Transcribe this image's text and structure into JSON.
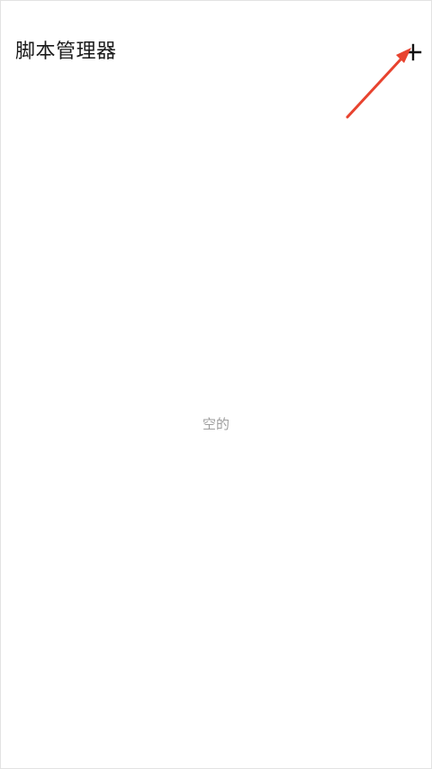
{
  "header": {
    "title": "脚本管理器",
    "add_icon": "plus-icon"
  },
  "main": {
    "empty_text": "空的"
  },
  "colors": {
    "background": "#ffffff",
    "title_text": "#1a1a1a",
    "empty_text": "#9e9e9e",
    "annotation_arrow": "#e8432f"
  }
}
